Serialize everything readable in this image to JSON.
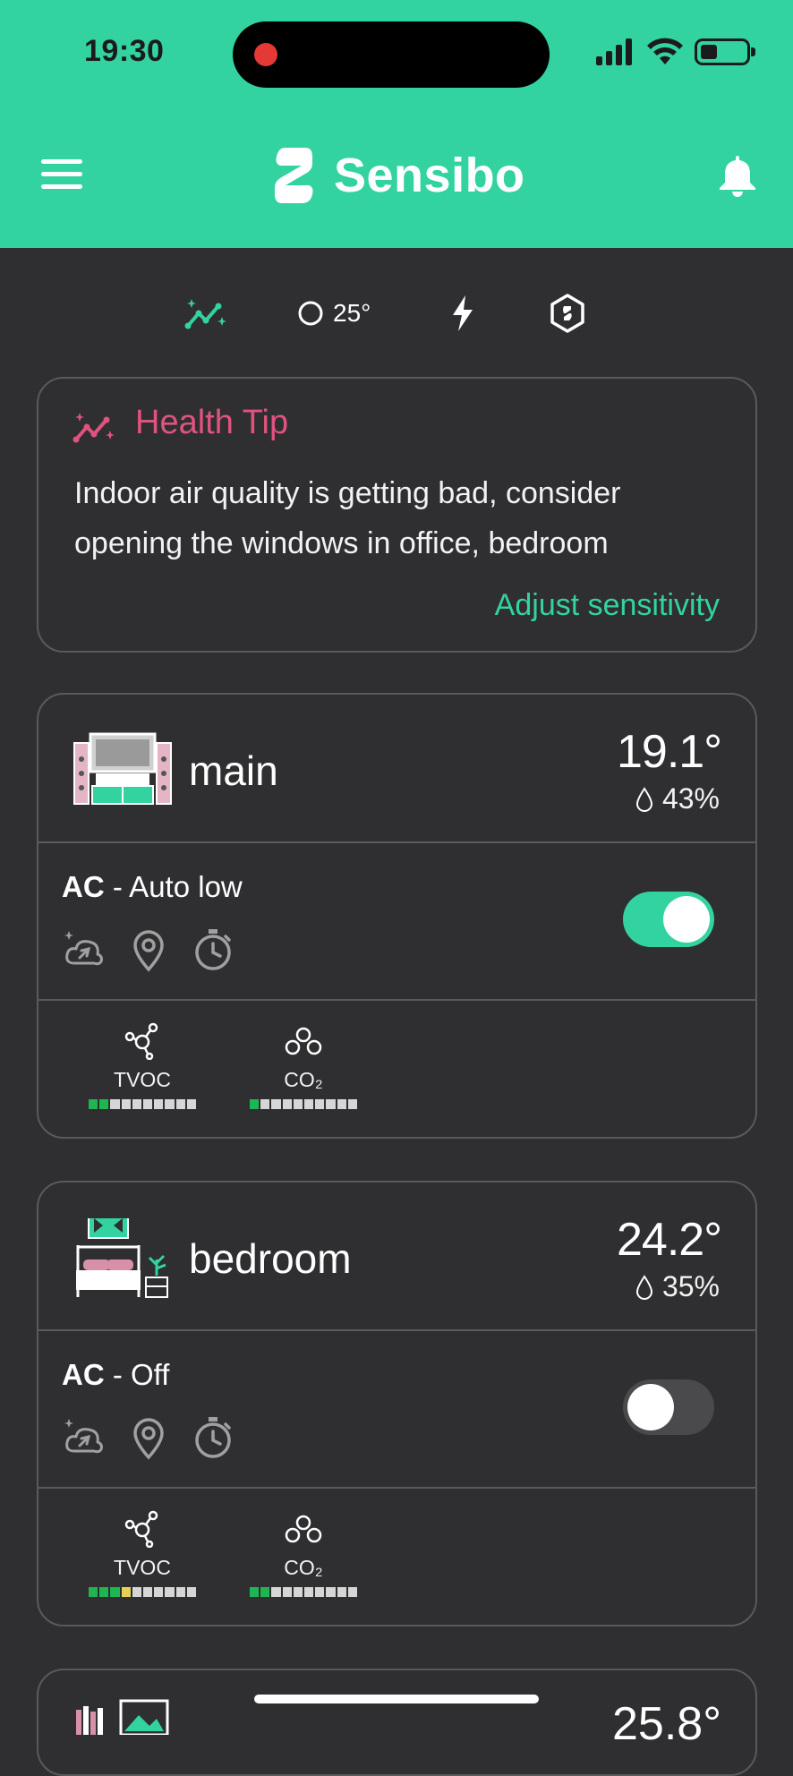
{
  "status_bar": {
    "time": "19:30"
  },
  "header": {
    "app_name": "Sensibo"
  },
  "toolbar": {
    "outdoor_temp": "25°"
  },
  "health_tip": {
    "title": "Health Tip",
    "body": "Indoor air quality is getting bad, consider opening the windows in office, bedroom",
    "link": "Adjust sensitivity"
  },
  "rooms": [
    {
      "name": "main",
      "temperature": "19.1°",
      "humidity": "43%",
      "ac_label": "AC",
      "ac_state": " - Auto low",
      "ac_on": true,
      "metrics": [
        {
          "name": "TVOC",
          "level_of_10": 2
        },
        {
          "name": "CO₂",
          "level_of_10": 1
        }
      ]
    },
    {
      "name": "bedroom",
      "temperature": "24.2°",
      "humidity": "35%",
      "ac_label": "AC",
      "ac_state": " - Off",
      "ac_on": false,
      "metrics": [
        {
          "name": "TVOC",
          "level_of_10": 4
        },
        {
          "name": "CO₂",
          "level_of_10": 2
        }
      ]
    },
    {
      "temperature": "25.8°"
    }
  ],
  "colors": {
    "brand": "#33d3a1",
    "background": "#2f2e30",
    "health_title": "#e0537f",
    "aq_good": "#1fb551",
    "aq_moderate": "#e7d05a"
  }
}
